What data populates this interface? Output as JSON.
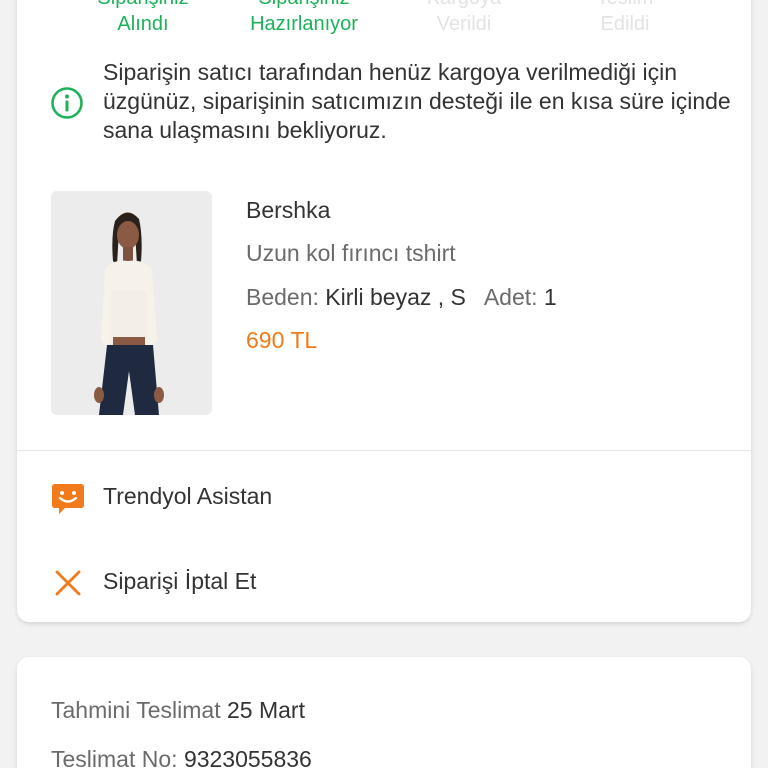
{
  "status_steps": [
    {
      "line1": "Siparişiniz",
      "line2": "Alındı",
      "state": "active"
    },
    {
      "line1": "Siparişiniz",
      "line2": "Hazırlanıyor",
      "state": "active"
    },
    {
      "line1": "Kargoya",
      "line2": "Verildi",
      "state": "inactive"
    },
    {
      "line1": "Teslim",
      "line2": "Edildi",
      "state": "inactive"
    }
  ],
  "info": {
    "icon": "info-icon",
    "text": "Siparişin satıcı tarafından henüz kargoya verilmediği için üzgünüz, siparişinin satıcımızın desteği ile en kısa süre içinde sana ulaşmasını bekliyoruz."
  },
  "product": {
    "brand": "Bershka",
    "name": "Uzun kol fırıncı tshirt",
    "size_label": "Beden:",
    "size_value": "Kirli beyaz , S",
    "qty_label": "Adet:",
    "qty_value": "1",
    "price": "690 TL"
  },
  "actions": {
    "assistant_label": "Trendyol Asistan",
    "assistant_icon": "chat-assistant-icon",
    "cancel_label": "Siparişi İptal Et",
    "cancel_icon": "close-icon"
  },
  "delivery": {
    "estimate_label": "Tahmini Teslimat",
    "estimate_value": "25 Mart",
    "number_label": "Teslimat No:",
    "number_value": "9323055836"
  },
  "colors": {
    "accent_green": "#1db25a",
    "accent_orange": "#f27a1a",
    "inactive_gray": "#e3e3e3"
  }
}
